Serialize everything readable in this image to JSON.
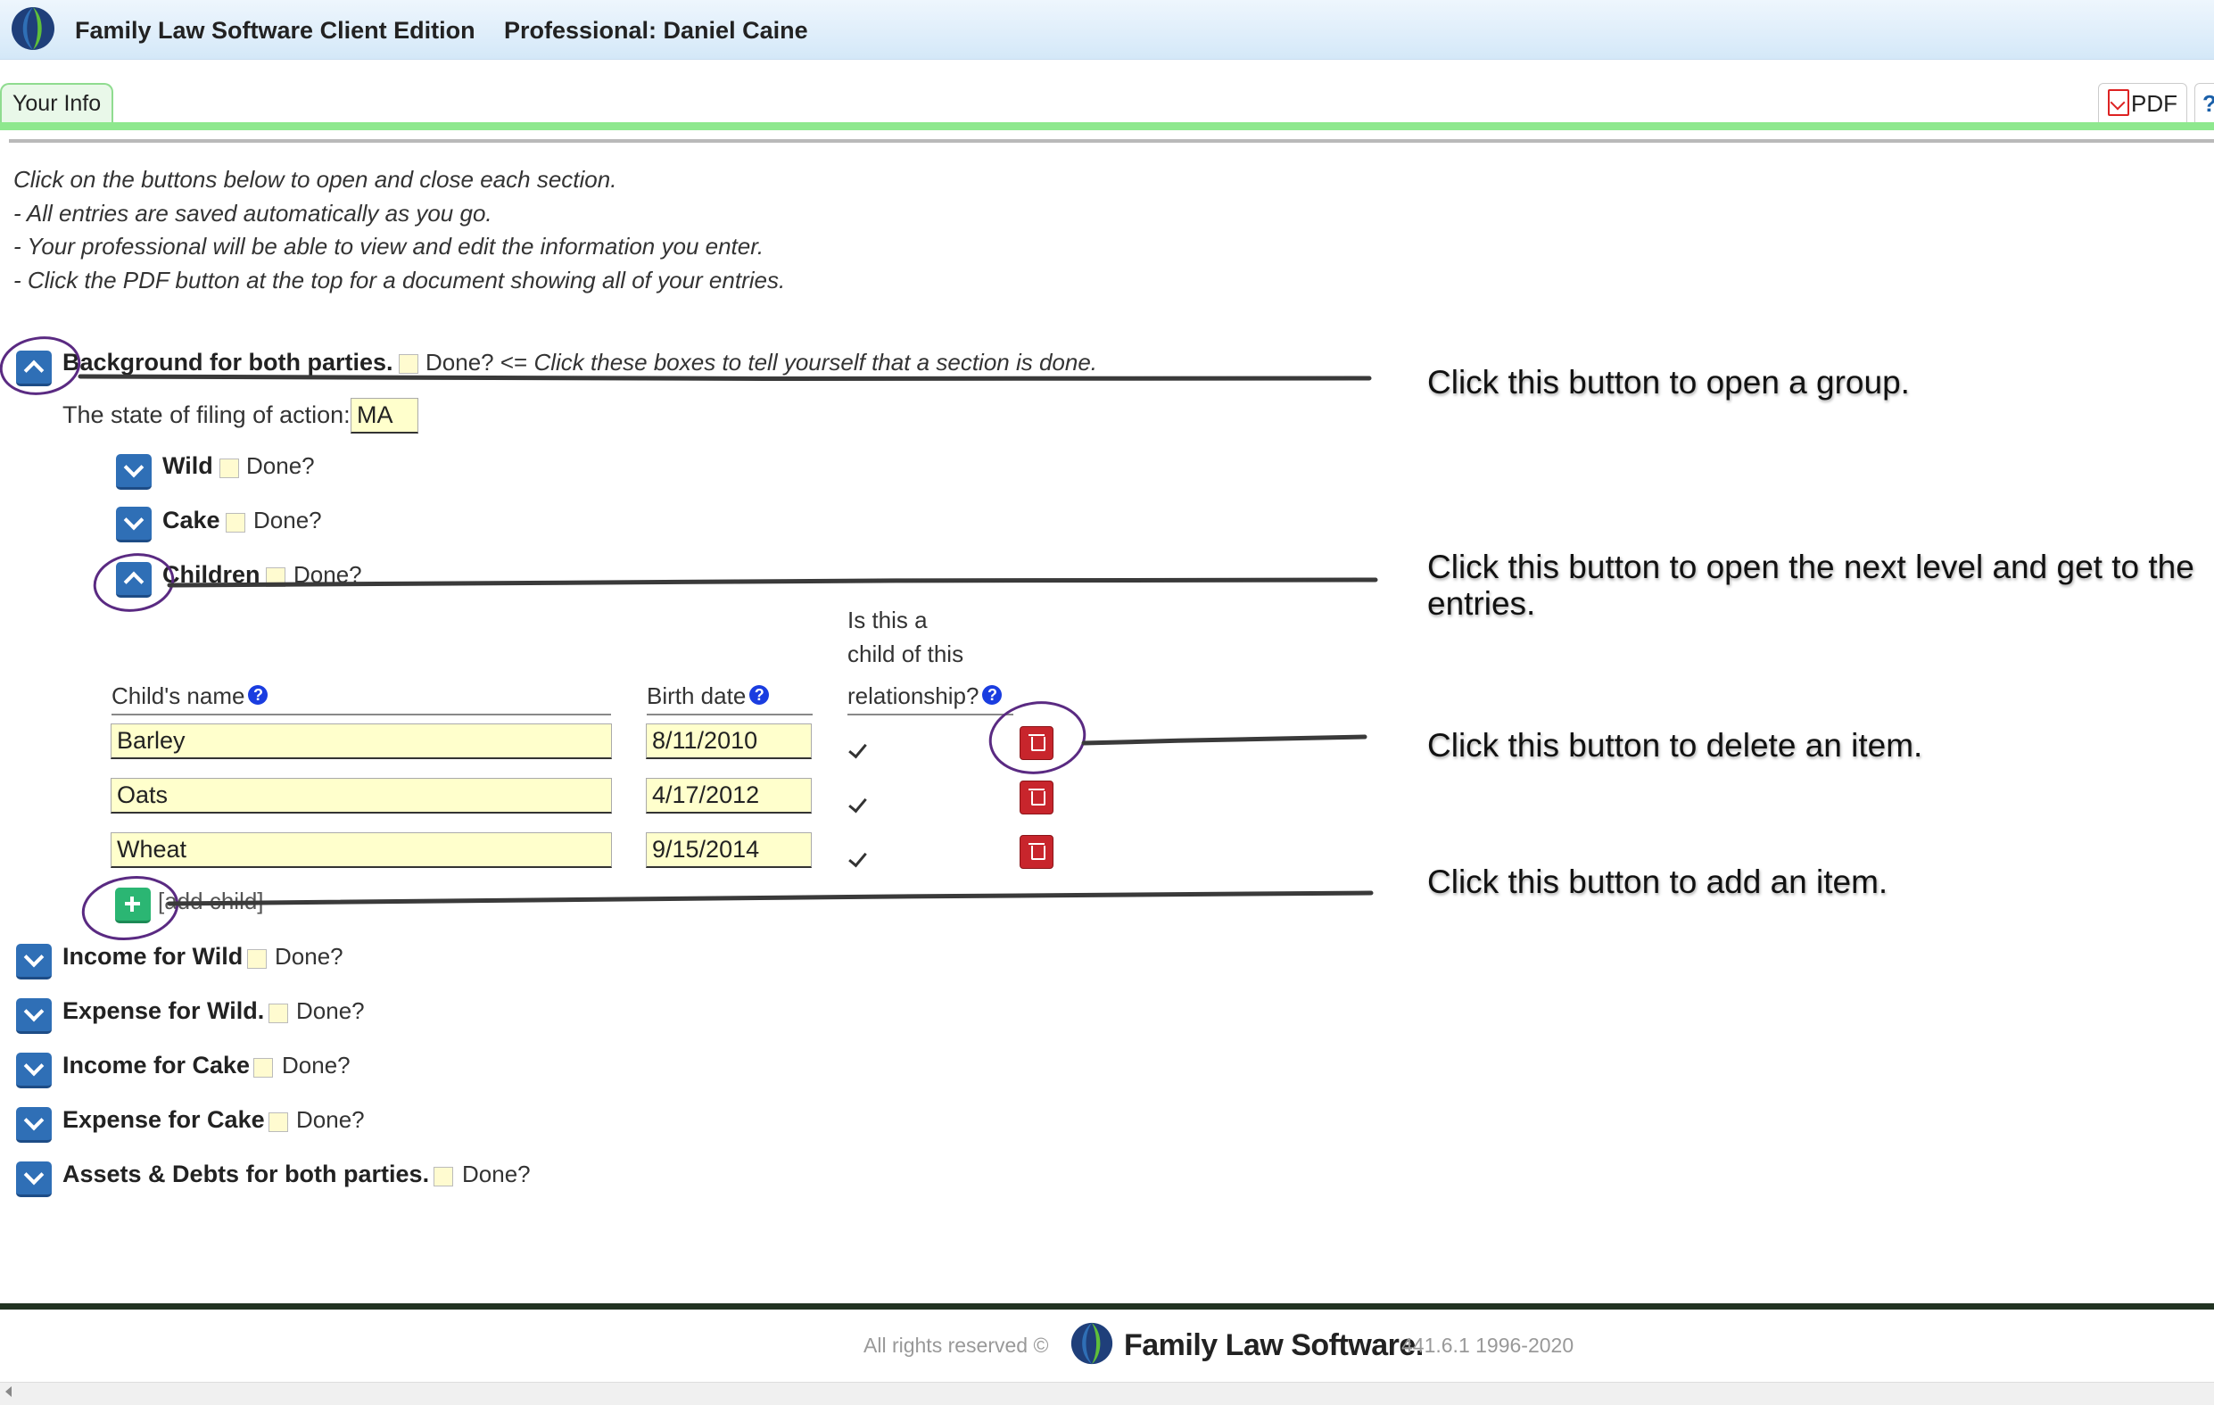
{
  "header": {
    "app_title": "Family Law Software Client Edition",
    "professional": "Professional: Daniel Caine"
  },
  "tabs": {
    "your_info": "Your Info",
    "pdf": "PDF",
    "help": "?"
  },
  "instructions": [
    "Click on the buttons below to open and close each section.",
    "- All entries are saved automatically as you go.",
    "- Your professional will be able to view and edit the information you enter.",
    "- Click the PDF button at the top for a document showing all of your entries."
  ],
  "done_label": "Done?",
  "background": {
    "label": "Background for both parties.",
    "hint_prefix": "<=",
    "hint_text": "Click these boxes to tell yourself that a section is done.",
    "state_label": "The state of filing of action:",
    "state_value": "MA"
  },
  "subgroups": {
    "wild": "Wild",
    "cake": "Cake",
    "children": "Children"
  },
  "children_table": {
    "col_name": "Child's name",
    "col_birth": "Birth date",
    "col_relationship_lines": [
      "Is this a",
      "child of this",
      "relationship?"
    ],
    "help_glyph": "?",
    "rows": [
      {
        "name": "Barley",
        "birth": "8/11/2010",
        "of_relationship": true
      },
      {
        "name": "Oats",
        "birth": "4/17/2012",
        "of_relationship": true
      },
      {
        "name": "Wheat",
        "birth": "9/15/2014",
        "of_relationship": true
      }
    ],
    "add_label": "[add child]"
  },
  "sections": [
    "Income for Wild",
    "Expense for Wild.",
    "Income for Cake",
    "Expense for Cake",
    "Assets & Debts for both parties."
  ],
  "callouts": {
    "open_group": "Click this button to open a group.",
    "open_next_line1": "Click this button to open the next level and get to the",
    "open_next_line2": "entries.",
    "delete_item": "Click this button to delete an item.",
    "add_item": "Click this button to add an item."
  },
  "footer": {
    "copyright": "All rights reserved ©",
    "brand": "Family Law Software.",
    "version": "441.6.1 1996-2020"
  },
  "colors": {
    "toggle_blue": "#2f6fb6",
    "delete_red": "#c8252c",
    "add_green": "#2bb673",
    "field_yellow": "#ffffcc",
    "tab_green": "#8ee88e",
    "annotation_purple": "#5a2a82"
  }
}
